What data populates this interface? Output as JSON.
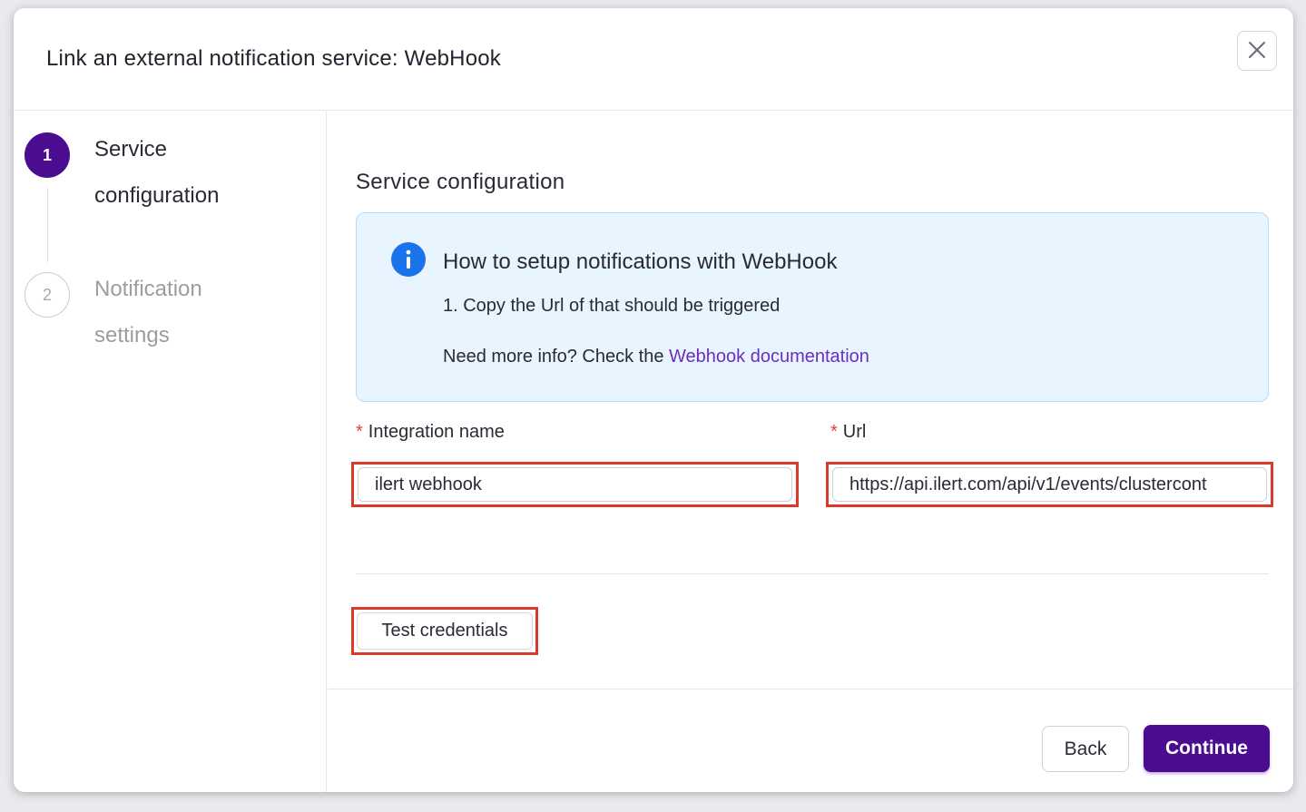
{
  "modal": {
    "title": "Link an external notification service: WebHook",
    "close_icon": "close-icon"
  },
  "steps": [
    {
      "number": "1",
      "label": "Service configuration",
      "state": "active"
    },
    {
      "number": "2",
      "label": "Notification settings",
      "state": "inactive"
    }
  ],
  "main": {
    "section_title": "Service configuration",
    "info": {
      "icon": "info-icon",
      "heading": "How to setup notifications with WebHook",
      "step_1": "1. Copy the Url of that should be triggered",
      "more_prefix": "Need more info? Check the ",
      "more_link": "Webhook documentation"
    },
    "fields": {
      "required_mark": "*",
      "integration_name": {
        "label": "Integration name",
        "value": "ilert webhook"
      },
      "url": {
        "label": "Url",
        "value": "https://api.ilert.com/api/v1/events/clustercont"
      }
    },
    "test_button": "Test credentials"
  },
  "footer": {
    "back_label": "Back",
    "continue_label": "Continue"
  },
  "colors": {
    "brand_purple": "#4b0c8f",
    "link_purple": "#6b2fc0",
    "info_blue": "#1a73e8",
    "info_bg": "#e8f4fe",
    "highlight_red": "#d9382a"
  }
}
